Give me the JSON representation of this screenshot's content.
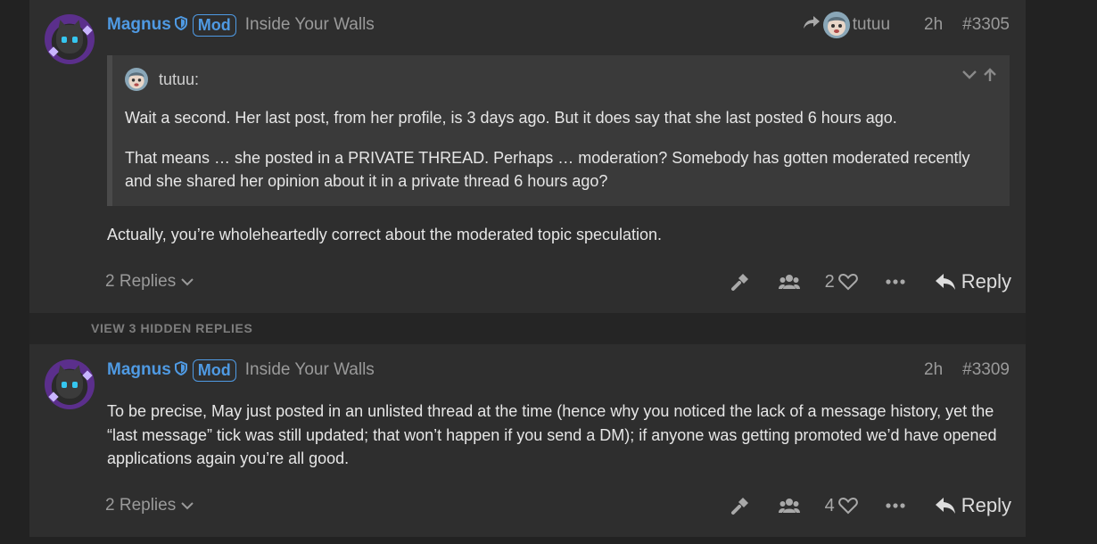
{
  "colors": {
    "accent": "#4f9ae3",
    "post_bg": "#2e2e2e",
    "page_bg": "#222222",
    "quote_bg": "#3a3a3a"
  },
  "posts": [
    {
      "author": "Magnus",
      "badge": "Mod",
      "flair": "Inside Your Walls",
      "reply_to": "tutuu",
      "time": "2h",
      "number": "#3305",
      "quote": {
        "author": "tutuu:",
        "paragraphs": [
          "Wait a second. Her last post, from her profile, is 3 days ago. But it does say that she last posted 6 hours ago.",
          "That means … she posted in a PRIVATE THREAD. Perhaps … moderation? Somebody has gotten moderated recently and she shared her opinion about it in a private thread 6 hours ago?"
        ]
      },
      "body": "Actually, you’re wholeheartedly correct about the moderated topic speculation.",
      "replies_label": "2 Replies",
      "likes": "2",
      "reply_label": "Reply"
    },
    {
      "author": "Magnus",
      "badge": "Mod",
      "flair": "Inside Your Walls",
      "time": "2h",
      "number": "#3309",
      "body": "To be precise, May just posted in an unlisted thread at the time (hence why you noticed the lack of a message history, yet the “last message” tick was still updated; that won’t happen if you send a DM); if anyone was getting promoted we’d have opened applications again you’re all good.",
      "replies_label": "2 Replies",
      "likes": "4",
      "reply_label": "Reply"
    }
  ],
  "hidden_replies_label": "VIEW 3 HIDDEN REPLIES",
  "icons": [
    "shield-icon",
    "share-arrow-icon",
    "chevron-down-icon",
    "arrow-up-icon",
    "wrench-icon",
    "group-icon",
    "heart-icon",
    "ellipsis-icon",
    "reply-arrow-icon"
  ]
}
